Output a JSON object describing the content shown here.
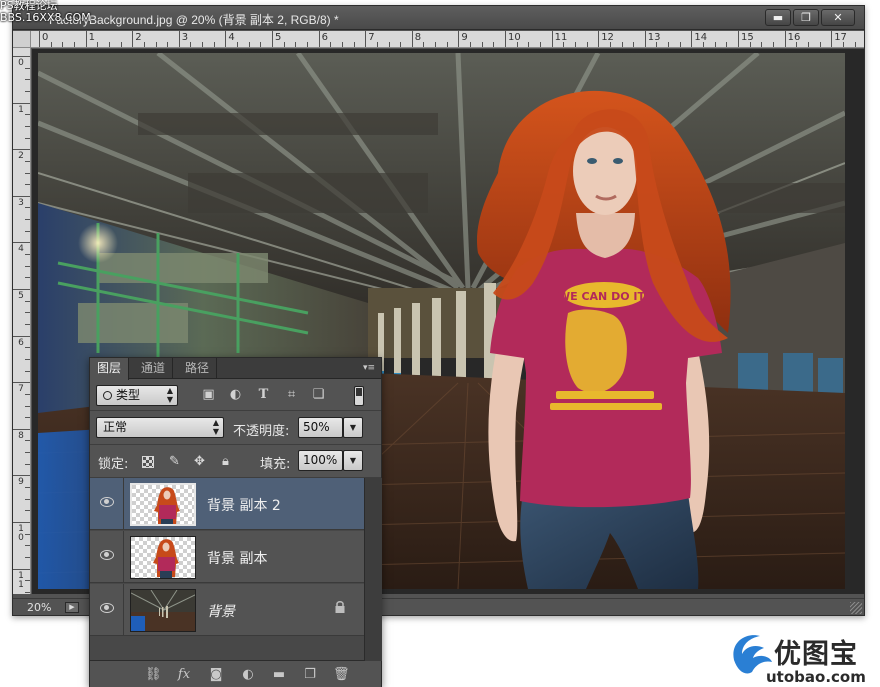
{
  "watermark": {
    "line1": "PS教程论坛",
    "line2": "BBS.16XX8.COM"
  },
  "document": {
    "title": "FactoryBackground.jpg @ 20% (背景 副本 2, RGB/8) *",
    "zoom": "20%",
    "controls": {
      "minimize": "▬",
      "maximize": "❐",
      "close": "✕"
    },
    "ruler_h": [
      "0",
      "1",
      "2",
      "3",
      "4",
      "5",
      "6",
      "7",
      "8",
      "9",
      "10",
      "11",
      "12",
      "13",
      "14",
      "15",
      "16",
      "17"
    ],
    "ruler_v": [
      "0",
      "1",
      "2",
      "3",
      "4",
      "5",
      "6",
      "7",
      "8",
      "9",
      "10",
      "11"
    ]
  },
  "layers_panel": {
    "tabs": [
      "图层",
      "通道",
      "路径"
    ],
    "active_tab": "图层",
    "filter_kind": "类型",
    "blend_mode": "正常",
    "opacity_label": "不透明度:",
    "opacity_value": "50%",
    "lock_label": "锁定:",
    "fill_label": "填充:",
    "fill_value": "100%",
    "layers": [
      {
        "name": "背景 副本 2",
        "selected": true,
        "locked": false,
        "visible": true
      },
      {
        "name": "背景 副本",
        "selected": false,
        "locked": false,
        "visible": true
      },
      {
        "name": "背景",
        "selected": false,
        "locked": true,
        "visible": true
      }
    ],
    "bottom_fx": "fx"
  },
  "logo": {
    "title": "优图宝",
    "url": "utobao.com"
  },
  "colors": {
    "panel_bg": "#535353",
    "selected_layer": "#4f6077",
    "shirt": "#b22a5a",
    "shirt_print": "#e8b92d",
    "hair": "#c74a1a",
    "logo_blue": "#2a7fd4"
  }
}
